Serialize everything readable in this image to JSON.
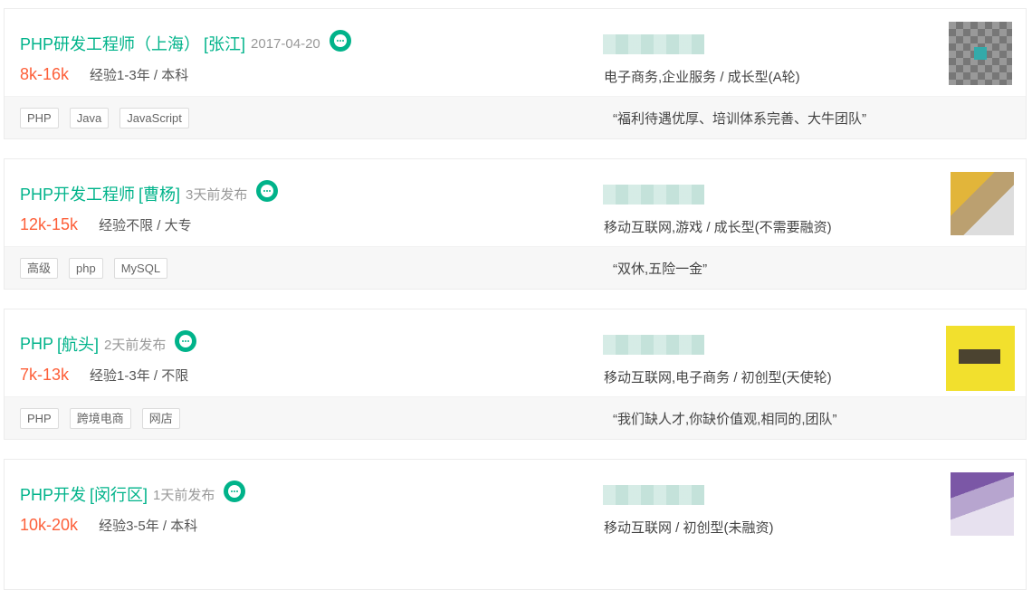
{
  "jobs": [
    {
      "title": "PHP研发工程师（上海）",
      "district": "[张江]",
      "date": "2017-04-20",
      "salary": "8k-16k",
      "requirements": "经验1-3年 / 本科",
      "company_info": "电子商务,企业服务 / 成长型(A轮)",
      "tags": [
        "PHP",
        "Java",
        "JavaScript"
      ],
      "quote": "“福利待遇优厚、培训体系完善、大牛团队”",
      "logo_icon": "company-logo"
    },
    {
      "title": "PHP开发工程师",
      "district": "[曹杨]",
      "date": "3天前发布",
      "salary": "12k-15k",
      "requirements": "经验不限 / 大专",
      "company_info": "移动互联网,游戏 / 成长型(不需要融资)",
      "tags": [
        "高级",
        "php",
        "MySQL"
      ],
      "quote": "“双休,五险一金”",
      "logo_icon": "company-logo"
    },
    {
      "title": "PHP",
      "district": "[航头]",
      "date": "2天前发布",
      "salary": "7k-13k",
      "requirements": "经验1-3年 / 不限",
      "company_info": "移动互联网,电子商务 / 初创型(天使轮)",
      "tags": [
        "PHP",
        "跨境电商",
        "网店"
      ],
      "quote": "“我们缺人才,你缺价值观,相同的,团队”",
      "logo_icon": "company-logo"
    },
    {
      "title": "PHP开发",
      "district": "[闵行区]",
      "date": "1天前发布",
      "salary": "10k-20k",
      "requirements": "经验3-5年 / 本科",
      "company_info": "移动互联网 / 初创型(未融资)",
      "tags": [],
      "quote": "",
      "logo_icon": "company-logo"
    }
  ]
}
